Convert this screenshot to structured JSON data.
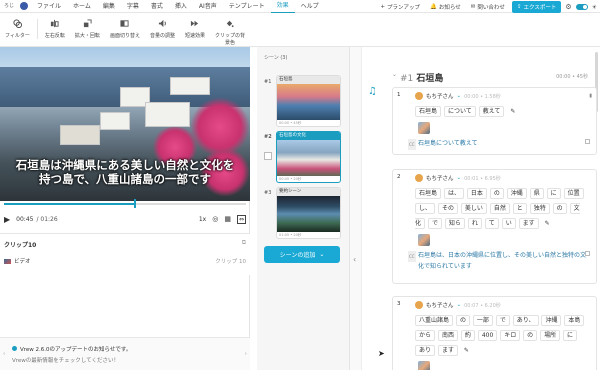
{
  "app": {
    "logo_text": "ろじ",
    "colors": {
      "accent": "#1a9dbf",
      "export": "#1aa9d4"
    }
  },
  "menu": {
    "items": [
      "ファイル",
      "ホーム",
      "編集",
      "字幕",
      "書式",
      "挿入",
      "AI音声",
      "テンプレート",
      "効果",
      "ヘルプ"
    ],
    "active_index": 8
  },
  "right_tools": {
    "plan": "プランアップ",
    "notice": "お知らせ",
    "contact": "問い合わせ",
    "export": "エクスポート"
  },
  "toolbar": {
    "filter": "フィルター",
    "flip": "左右反転",
    "zoom_rotate": "拡大・回転",
    "screen_switch": "画面切り替え",
    "volume": "音量の調整",
    "speed": "短速効果",
    "clip_color": "クリップの背",
    "clip_color2": "景色"
  },
  "video": {
    "subtitle_line1": "石垣島は沖縄県にある美しい自然と文化を",
    "subtitle_line2": "持つ島で、八重山諸島の一部です",
    "current_time": "00:45",
    "total_time": "/ 01:26",
    "speed": "1x",
    "progress": 0.54
  },
  "clip_panel": {
    "title": "クリップ10",
    "item_label": "ビデオ",
    "item_value": "クリップ 10"
  },
  "notice": {
    "title": "Vrew 2.6.0のアップデートのお知らせです。",
    "body": "Vrewの最新情報をチェックしてください！"
  },
  "scenes": {
    "header": "シーン (3)",
    "items": [
      {
        "num": "#1",
        "name": "石垣島",
        "meta": "00:00 • 45秒"
      },
      {
        "num": "#2",
        "name": "石垣島の文化",
        "meta": "00:45 • 20秒"
      },
      {
        "num": "#3",
        "name": "要約シーン",
        "meta": "01:05 • 20秒"
      }
    ],
    "active_index": 1,
    "add_button": "シーンの追加"
  },
  "editor": {
    "scene_num": "#1",
    "scene_name": "石垣島",
    "scene_meta": "00:00 • 45秒",
    "clips": [
      {
        "num": "1",
        "speaker": "もち子さん",
        "time": "00:00 • 1.58秒",
        "words": [
          "石垣島",
          "について",
          "教えて"
        ],
        "subtitle": "石垣島について教えて"
      },
      {
        "num": "2",
        "speaker": "もち子さん",
        "time": "00:01 • 6.95秒",
        "words": [
          "石垣島",
          "は、",
          "日本",
          "の",
          "沖縄",
          "県",
          "に",
          "位置",
          "し、",
          "その",
          "美しい",
          "自然",
          "と",
          "独特",
          "の",
          "文化",
          "で",
          "知ら",
          "れ",
          "て",
          "い",
          "ます"
        ],
        "subtitle": "石垣島は、日本の沖縄県に位置し、その美しい自然と独特の文化で知られています"
      },
      {
        "num": "3",
        "speaker": "もち子さん",
        "time": "00:07 • 6.20秒",
        "words": [
          "八重山諸島",
          "の",
          "一部",
          "で",
          "あり、",
          "沖縄",
          "本島",
          "から",
          "南西",
          "約",
          "400",
          "キロ",
          "の",
          "場所",
          "に",
          "あり",
          "ます"
        ],
        "subtitle": ""
      }
    ]
  }
}
